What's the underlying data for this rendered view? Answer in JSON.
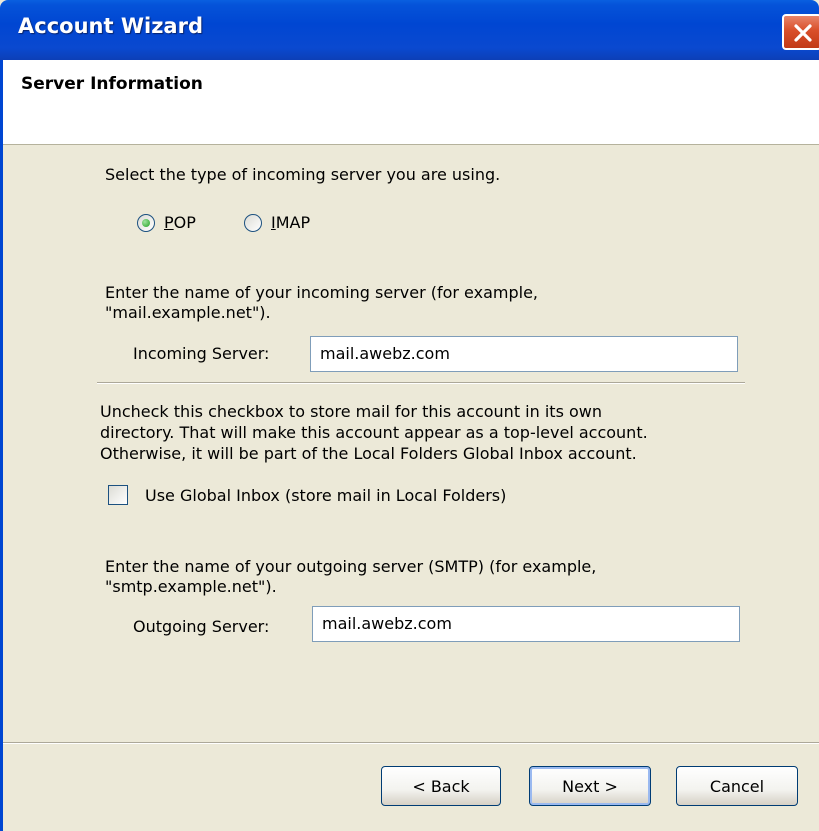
{
  "window": {
    "title": "Account Wizard",
    "close_icon": "close-icon"
  },
  "header": {
    "title": "Server Information"
  },
  "incoming_type": {
    "prompt": "Select the type of incoming server you are using.",
    "options": [
      {
        "label": "POP",
        "access_key": "P",
        "selected": true
      },
      {
        "label": "IMAP",
        "access_key": "I",
        "selected": false
      }
    ]
  },
  "incoming": {
    "prompt_line1": "Enter the name of your incoming server (for example,",
    "prompt_line2": "\"mail.example.net\").",
    "label": "Incoming Server:",
    "value": "mail.awebz.com"
  },
  "global_inbox": {
    "desc_line1": "Uncheck this checkbox to store mail for this account in its own",
    "desc_line2": "directory. That will make this account appear as a top-level account.",
    "desc_line3": "Otherwise, it will be part of the Local Folders Global Inbox account.",
    "checkbox_label": "Use Global Inbox (store mail in Local Folders)",
    "checked": false
  },
  "outgoing": {
    "prompt_line1": "Enter the name of your outgoing server (SMTP) (for example,",
    "prompt_line2": "\"smtp.example.net\").",
    "label": "Outgoing Server:",
    "value": "mail.awebz.com"
  },
  "buttons": {
    "back": "< Back",
    "next": "Next >",
    "cancel": "Cancel"
  },
  "colors": {
    "titlebar": "#0046d2",
    "dialog_bg": "#ece9d8",
    "radio_selected": "#21a121"
  }
}
